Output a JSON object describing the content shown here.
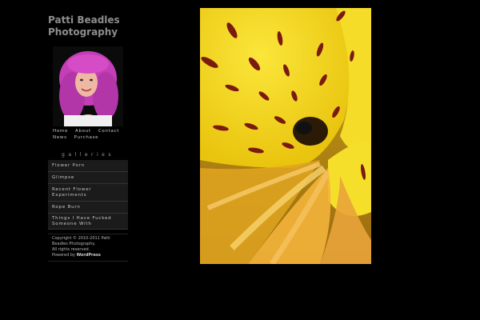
{
  "site": {
    "title_line1": "Patti Beadles",
    "title_line2": "Photography"
  },
  "nav": {
    "items": [
      "Home",
      "About",
      "Contact",
      "News",
      "Purchase"
    ]
  },
  "galleries": {
    "heading": "galleries",
    "items": [
      "Flower Porn",
      "Glimpse",
      "Recent Flower Experiments",
      "Rope Burn",
      "Things I Have Fucked Someone With"
    ]
  },
  "footer": {
    "copyright": "Copyright © 2010-2011 Patti Beadles Photography.",
    "rights": "All rights reserved.",
    "powered_prefix": "Powered by",
    "powered_link": "WordPress"
  },
  "colors": {
    "background": "#000000",
    "title": "#8d8d8d",
    "menu_bg": "#1b1b1b",
    "flower_yellow": "#f3d91c",
    "flower_spots": "#7a1a10"
  }
}
